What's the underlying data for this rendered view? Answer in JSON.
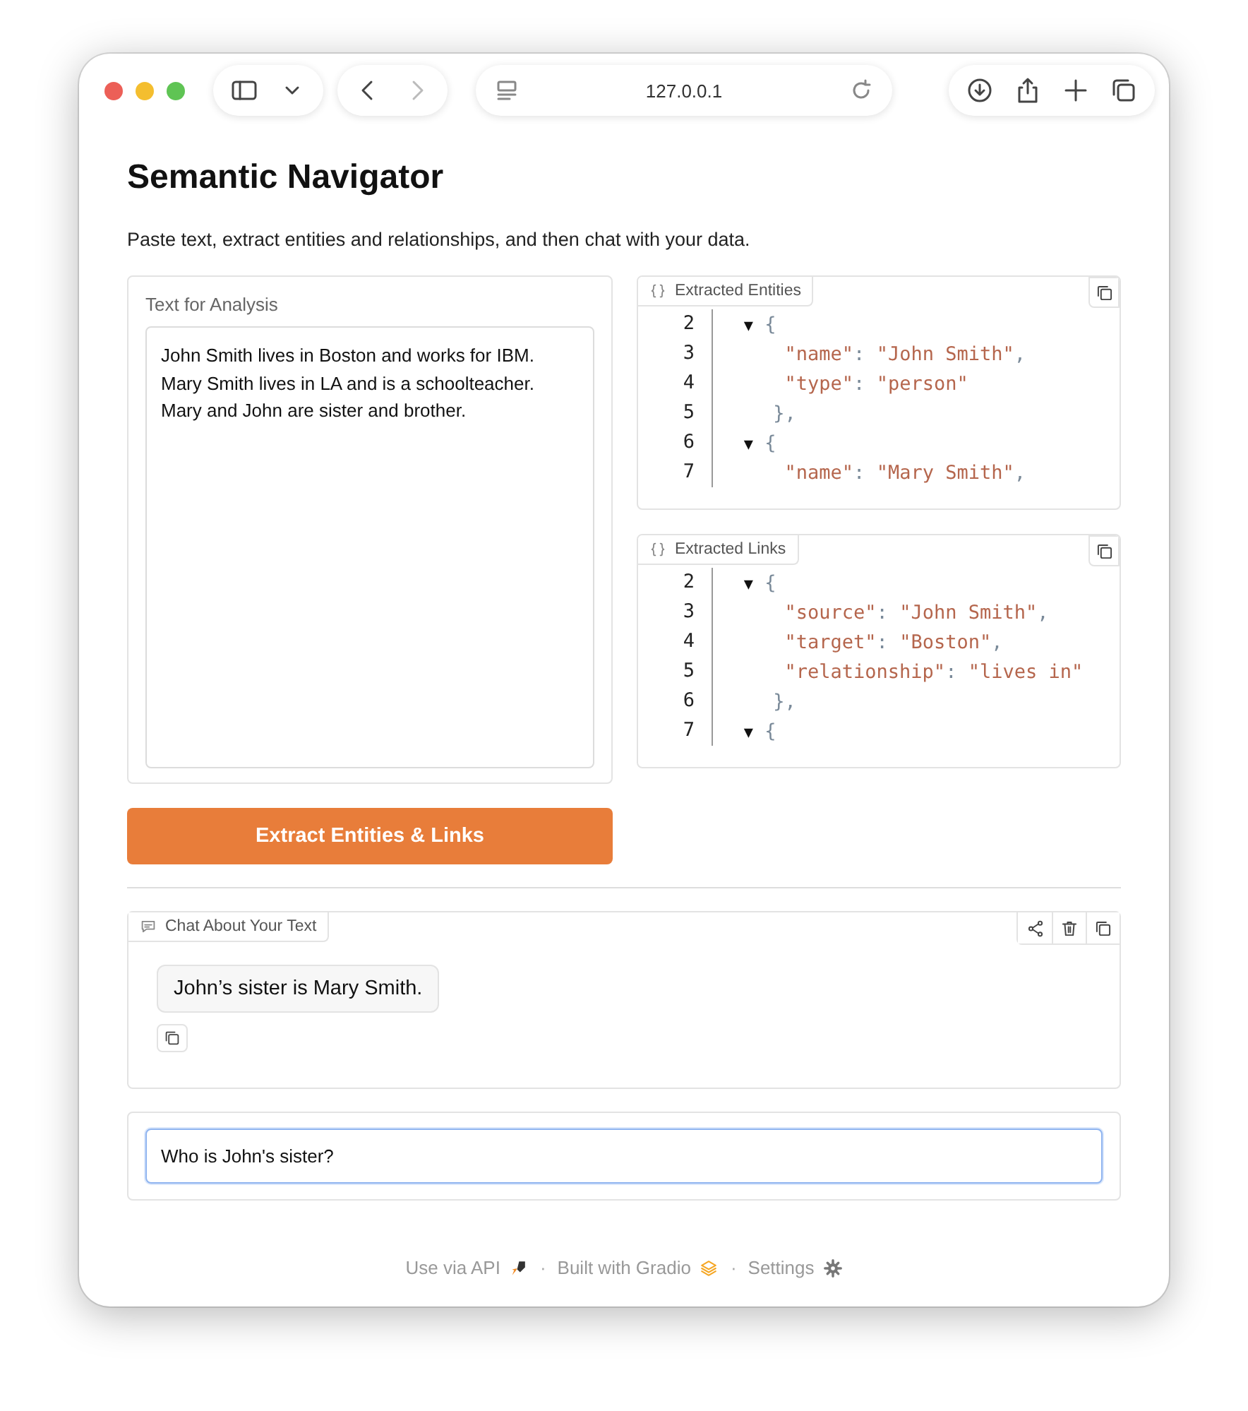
{
  "browser": {
    "url": "127.0.0.1"
  },
  "app": {
    "title": "Semantic Navigator",
    "description": "Paste text, extract entities and relationships, and then chat with your data."
  },
  "input_panel": {
    "label": "Text for Analysis",
    "value": "John Smith lives in Boston and works for IBM. Mary Smith lives in LA and is a schoolteacher. Mary and John are sister and brother."
  },
  "json_panels": [
    {
      "label": "Extracted Entities",
      "lines": [
        {
          "number": "2",
          "parts": [
            {
              "kind": "toggle",
              "text": "   ▼"
            },
            {
              "kind": "punct",
              "text": " {"
            }
          ]
        },
        {
          "number": "3",
          "parts": [
            {
              "kind": "string",
              "text": "      \"name\""
            },
            {
              "kind": "punct",
              "text": ": "
            },
            {
              "kind": "string",
              "text": "\"John Smith\""
            },
            {
              "kind": "punct",
              "text": ","
            }
          ]
        },
        {
          "number": "4",
          "parts": [
            {
              "kind": "string",
              "text": "      \"type\""
            },
            {
              "kind": "punct",
              "text": ": "
            },
            {
              "kind": "string",
              "text": "\"person\""
            }
          ]
        },
        {
          "number": "5",
          "parts": [
            {
              "kind": "punct",
              "text": "     },"
            }
          ]
        },
        {
          "number": "6",
          "parts": [
            {
              "kind": "toggle",
              "text": "   ▼"
            },
            {
              "kind": "punct",
              "text": " {"
            }
          ]
        },
        {
          "number": "7",
          "parts": [
            {
              "kind": "string",
              "text": "      \"name\""
            },
            {
              "kind": "punct",
              "text": ": "
            },
            {
              "kind": "string",
              "text": "\"Mary Smith\""
            },
            {
              "kind": "punct",
              "text": ","
            }
          ]
        }
      ]
    },
    {
      "label": "Extracted Links",
      "lines": [
        {
          "number": "2",
          "parts": [
            {
              "kind": "toggle",
              "text": "   ▼"
            },
            {
              "kind": "punct",
              "text": " {"
            }
          ]
        },
        {
          "number": "3",
          "parts": [
            {
              "kind": "string",
              "text": "      \"source\""
            },
            {
              "kind": "punct",
              "text": ": "
            },
            {
              "kind": "string",
              "text": "\"John Smith\""
            },
            {
              "kind": "punct",
              "text": ","
            }
          ]
        },
        {
          "number": "4",
          "parts": [
            {
              "kind": "string",
              "text": "      \"target\""
            },
            {
              "kind": "punct",
              "text": ": "
            },
            {
              "kind": "string",
              "text": "\"Boston\""
            },
            {
              "kind": "punct",
              "text": ","
            }
          ]
        },
        {
          "number": "5",
          "parts": [
            {
              "kind": "string",
              "text": "      \"relationship\""
            },
            {
              "kind": "punct",
              "text": ": "
            },
            {
              "kind": "string",
              "text": "\"lives in\""
            }
          ]
        },
        {
          "number": "6",
          "parts": [
            {
              "kind": "punct",
              "text": "     },"
            }
          ]
        },
        {
          "number": "7",
          "parts": [
            {
              "kind": "toggle",
              "text": "   ▼"
            },
            {
              "kind": "punct",
              "text": " {"
            }
          ]
        }
      ]
    }
  ],
  "extract_button": {
    "label": "Extract Entities & Links"
  },
  "chat": {
    "label": "Chat About Your Text",
    "messages": [
      {
        "kind": "bot",
        "text": "John’s sister is Mary Smith."
      }
    ]
  },
  "message_input": {
    "value": "Who is John's sister?",
    "focused": true
  },
  "footer": {
    "separator": "·",
    "links": [
      {
        "kind": "api",
        "label": "Use via API"
      },
      {
        "kind": "gradio",
        "label": "Built with Gradio"
      },
      {
        "kind": "settings",
        "label": "Settings"
      }
    ]
  }
}
